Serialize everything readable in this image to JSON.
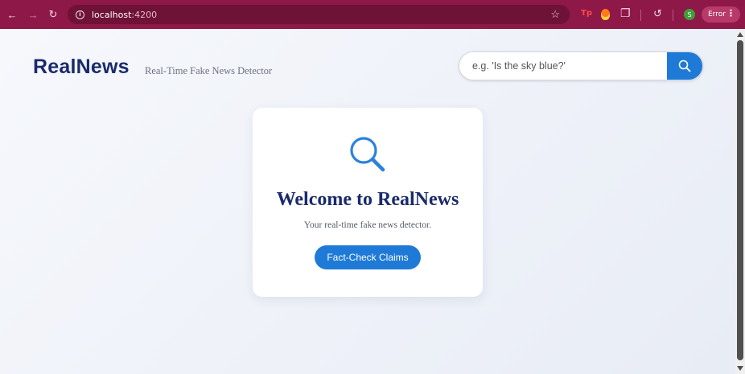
{
  "browser": {
    "back_icon": "arrow-left-icon",
    "forward_icon": "arrow-right-icon",
    "reload_icon": "reload-icon",
    "url_host": "localhost",
    "url_port": ":4200",
    "star_icon": "star-icon",
    "ext_tp_label": "Tp",
    "profile_initial": "S",
    "error_label": "Error",
    "chrome_color": "#8e1848"
  },
  "header": {
    "logo": "RealNews",
    "tagline": "Real-Time Fake News Detector"
  },
  "search": {
    "placeholder": "e.g. 'Is the sky blue?'",
    "button_icon": "search-icon"
  },
  "welcome_card": {
    "title": "Welcome to RealNews",
    "subtitle": "Your real-time fake news detector.",
    "button_label": "Fact-Check Claims",
    "icon": "magnifier-icon"
  },
  "colors": {
    "accent": "#1e7ad6",
    "brand_dark": "#1a2b6b"
  }
}
